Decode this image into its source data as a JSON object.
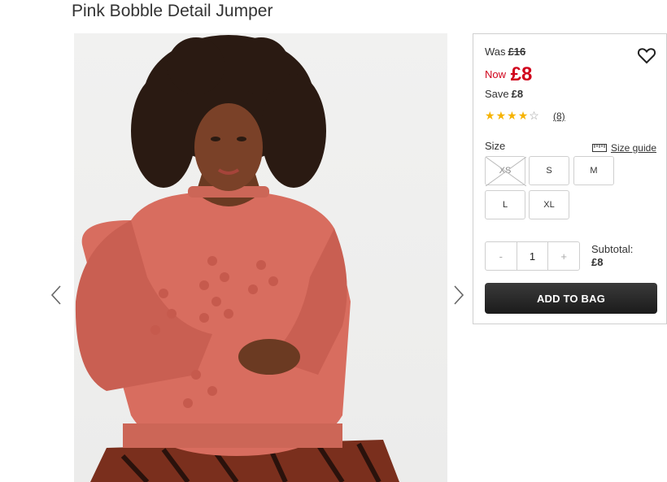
{
  "product": {
    "title": "Pink Bobble Detail Jumper"
  },
  "pricing": {
    "was_label": "Was",
    "was_price": "£16",
    "now_label": "Now",
    "now_price": "£8",
    "save_label": "Save",
    "save_amount": "£8"
  },
  "rating": {
    "stars_filled": 4,
    "stars_total": 5,
    "review_count": "(8)"
  },
  "size": {
    "label": "Size",
    "guide_label": "Size guide",
    "options": [
      {
        "label": "XS",
        "available": false
      },
      {
        "label": "S",
        "available": true
      },
      {
        "label": "M",
        "available": true
      },
      {
        "label": "L",
        "available": true
      },
      {
        "label": "XL",
        "available": true
      }
    ]
  },
  "quantity": {
    "minus": "-",
    "value": "1",
    "plus": "+"
  },
  "subtotal": {
    "label": "Subtotal:",
    "amount": "£8"
  },
  "cta": {
    "add_to_bag": "ADD TO BAG"
  },
  "icons": {
    "wishlist": "heart-icon",
    "prev": "chevron-left-icon",
    "next": "chevron-right-icon",
    "size_guide": "ruler-icon"
  },
  "colors": {
    "sale_red": "#d0021b",
    "star_gold": "#f6b300",
    "button_dark": "#222222"
  }
}
